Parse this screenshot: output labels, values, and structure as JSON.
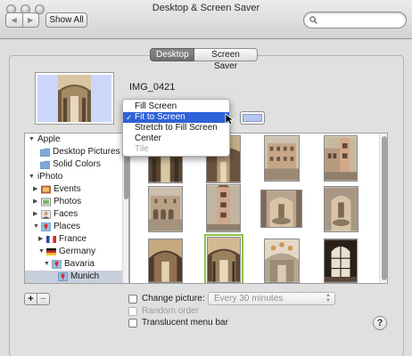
{
  "window": {
    "title": "Desktop & Screen Saver"
  },
  "toolbar": {
    "show_all_label": "Show All",
    "search_placeholder": ""
  },
  "tabs": [
    {
      "label": "Desktop",
      "active": true
    },
    {
      "label": "Screen Saver",
      "active": false
    }
  ],
  "preview": {
    "image_name": "IMG_0421"
  },
  "fit_menu": {
    "items": [
      {
        "label": "Fill Screen"
      },
      {
        "label": "Fit to Screen",
        "checked": true
      },
      {
        "label": "Stretch to Fill Screen"
      },
      {
        "label": "Center"
      },
      {
        "label": "Tile",
        "disabled": true
      }
    ]
  },
  "colors": {
    "desktop_swatch": "#b5c6f0",
    "selection": "#2e62d8",
    "selected_thumb_border": "#8bc43f"
  },
  "sidebar": {
    "items": [
      {
        "label": "Apple",
        "icon": "none",
        "expanded": true
      },
      {
        "label": "Desktop Pictures",
        "icon": "folder-icon"
      },
      {
        "label": "Solid Colors",
        "icon": "folder-icon"
      },
      {
        "label": "iPhoto",
        "icon": "none",
        "expanded": true
      },
      {
        "label": "Events",
        "icon": "events-icon"
      },
      {
        "label": "Photos",
        "icon": "photos-icon"
      },
      {
        "label": "Faces",
        "icon": "faces-icon"
      },
      {
        "label": "Places",
        "icon": "places-icon",
        "expanded": true
      },
      {
        "label": "France",
        "icon": "france-flag-icon"
      },
      {
        "label": "Germany",
        "icon": "germany-flag-icon",
        "expanded": true
      },
      {
        "label": "Bavaria",
        "icon": "places-icon",
        "expanded": true
      },
      {
        "label": "Munich",
        "icon": "places-icon",
        "selected": true
      }
    ]
  },
  "thumbnails": {
    "images": [
      {
        "name": "interior-arch"
      },
      {
        "name": "interior-hall"
      },
      {
        "name": "courtyard-facade"
      },
      {
        "name": "courtyard-tower"
      },
      {
        "name": "courtyard-arcade"
      },
      {
        "name": "tower-facade"
      },
      {
        "name": "fountain-statue"
      },
      {
        "name": "fountain-niche"
      },
      {
        "name": "vaulted-hall"
      },
      {
        "name": "vaulted-hall-2",
        "selected": true
      },
      {
        "name": "ornate-ceiling"
      },
      {
        "name": "stained-window"
      }
    ]
  },
  "options": {
    "change_picture_label": "Change picture:",
    "change_picture_interval": "Every 30 minutes",
    "random_order_label": "Random order",
    "translucent_menu_bar_label": "Translucent menu bar"
  },
  "buttons": {
    "add": "+",
    "remove": "−",
    "help": "?"
  }
}
